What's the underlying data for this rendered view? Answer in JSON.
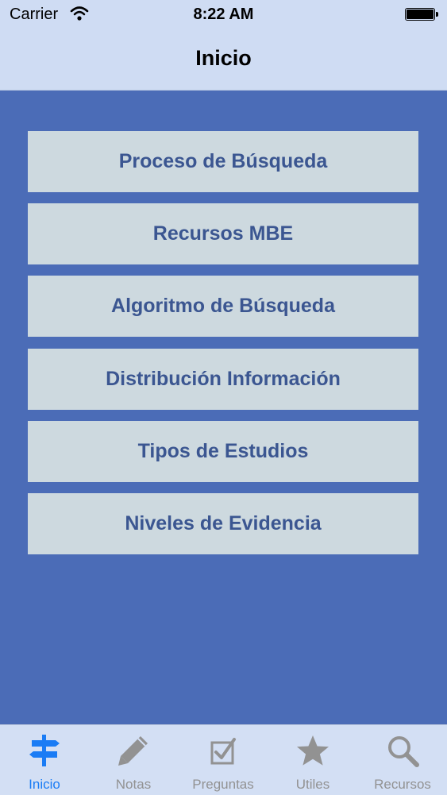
{
  "status_bar": {
    "carrier": "Carrier",
    "time": "8:22 AM",
    "wifi_icon": "wifi-icon",
    "battery_icon": "battery-icon"
  },
  "nav": {
    "title": "Inicio"
  },
  "menu": [
    {
      "label": "Proceso de Búsqueda"
    },
    {
      "label": "Recursos MBE"
    },
    {
      "label": "Algoritmo de Búsqueda"
    },
    {
      "label": "Distribución Información"
    },
    {
      "label": "Tipos de Estudios"
    },
    {
      "label": "Niveles de Evidencia"
    }
  ],
  "tabs": [
    {
      "label": "Inicio",
      "icon": "signpost-icon",
      "active": true
    },
    {
      "label": "Notas",
      "icon": "pencil-icon",
      "active": false
    },
    {
      "label": "Preguntas",
      "icon": "checkbox-icon",
      "active": false
    },
    {
      "label": "Utiles",
      "icon": "star-icon",
      "active": false
    },
    {
      "label": "Recursos",
      "icon": "search-icon",
      "active": false
    }
  ],
  "colors": {
    "background": "#4b6cb7",
    "bar": "#cfdcf3",
    "button": "#cdd9df",
    "button_text": "#3b5691",
    "tab_active": "#1a7cf5",
    "tab_inactive": "#929292"
  }
}
